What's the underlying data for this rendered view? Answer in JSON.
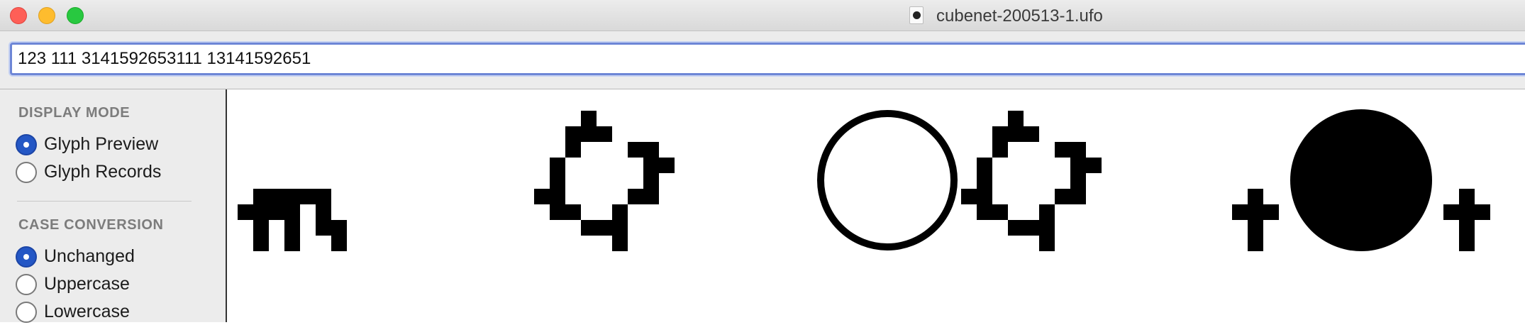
{
  "window": {
    "title": "cubenet-200513-1.ufo"
  },
  "toolbar": {
    "text_value": "123 111 3141592653111 13141592651"
  },
  "sidebar": {
    "display_mode": {
      "heading": "DISPLAY MODE",
      "options": [
        {
          "label": "Glyph Preview",
          "selected": true
        },
        {
          "label": "Glyph Records",
          "selected": false
        }
      ]
    },
    "case_conversion": {
      "heading": "CASE CONVERSION",
      "options": [
        {
          "label": "Unchanged",
          "selected": true
        },
        {
          "label": "Uppercase",
          "selected": false
        },
        {
          "label": "Lowercase",
          "selected": false
        }
      ]
    }
  },
  "colors": {
    "accent": "#2457c5",
    "focus_ring": "#6d86d6",
    "glyph": "#000000"
  },
  "icons": {
    "document": "ufo-document-icon",
    "close": "close-window-icon",
    "minimize": "minimize-window-icon",
    "zoom": "zoom-window-icon"
  }
}
